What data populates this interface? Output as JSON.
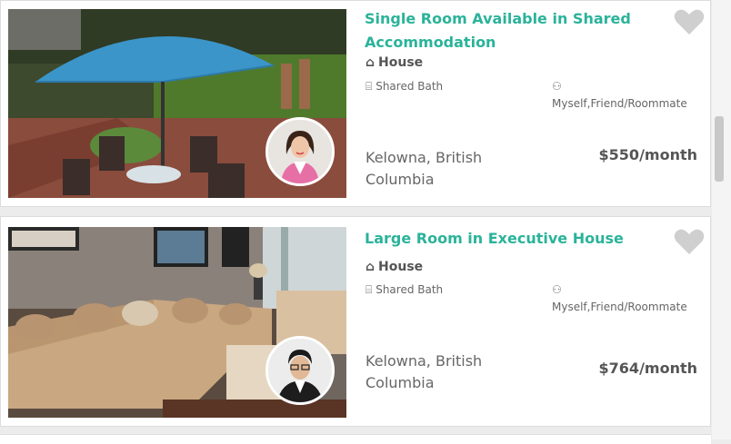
{
  "listings": [
    {
      "title": "Single Room Available in Shared Accommodation",
      "type_icon": "house-icon",
      "type": "House",
      "bath_icon": "bath-icon",
      "bath": "Shared Bath",
      "who_icon": "people-icon",
      "who": "Myself,Friend/Roommate",
      "location": "Kelowna, British Columbia",
      "price": "$550/month",
      "favorite_icon": "heart-icon"
    },
    {
      "title": "Large Room in Executive House",
      "type_icon": "house-icon",
      "type": "House",
      "bath_icon": "bath-icon",
      "bath": "Shared Bath",
      "who_icon": "people-icon",
      "who": "Myself,Friend/Roommate",
      "location": "Kelowna, British Columbia",
      "price": "$764/month",
      "favorite_icon": "heart-icon"
    }
  ],
  "colors": {
    "title": "#2bb39a",
    "heart": "#cfcfcf"
  }
}
